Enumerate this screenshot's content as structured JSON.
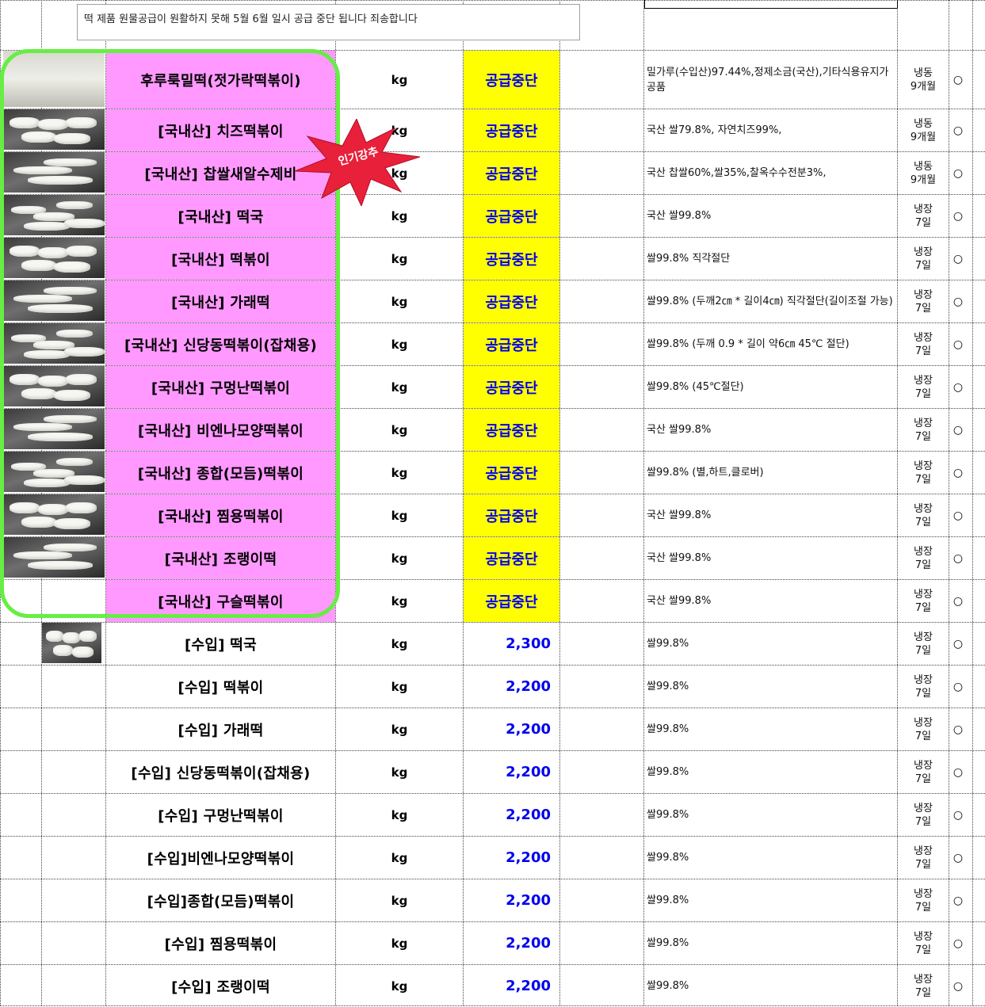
{
  "notice": "떡 제품 원물공급이 원활하지 못해 5월 6월 일시 공급 중단 됩니다 죄송합니다",
  "badge": "인기강추",
  "colors": {
    "highlight": "#ff99ff",
    "suspended_fill": "#ffff00",
    "price_text": "#0000ee",
    "outline": "#66ee44",
    "badge": "#e8203a"
  },
  "rows": [
    {
      "name": "후루룩밀떡(젓가락떡볶이)",
      "unit": "kg",
      "price": "공급중단",
      "desc": "밀가루(수입산)97.44%,정제소금(국산),기타식용유지가공품",
      "storage": [
        "냉동",
        "9개월"
      ],
      "mark": "○",
      "thumb": "product-photo-package-icon",
      "pink": true,
      "stop": true
    },
    {
      "name": "[국내산] 치즈떡볶이",
      "unit": "kg",
      "price": "공급중단",
      "desc": "국산 쌀79.8%, 자연치즈99%,",
      "storage": [
        "냉동",
        "9개월"
      ],
      "mark": "○",
      "thumb": "rice-cake-photo-icon",
      "pink": true,
      "stop": true
    },
    {
      "name": "[국내산] 찹쌀새알수제비",
      "unit": "kg",
      "price": "공급중단",
      "desc": "국산 찹쌀60%,쌀35%,찰옥수수전분3%,",
      "storage": [
        "냉동",
        "9개월"
      ],
      "mark": "○",
      "thumb": "rice-ball-photo-icon",
      "pink": true,
      "stop": true
    },
    {
      "name": "[국내산] 떡국",
      "unit": "kg",
      "price": "공급중단",
      "desc": "국산 쌀99.8%",
      "storage": [
        "냉장",
        "7일"
      ],
      "mark": "○",
      "thumb": "rice-cake-photo-icon",
      "pink": true,
      "stop": true
    },
    {
      "name": "[국내산] 떡볶이",
      "unit": "kg",
      "price": "공급중단",
      "desc": "쌀99.8%  직각절단",
      "storage": [
        "냉장",
        "7일"
      ],
      "mark": "○",
      "thumb": "rice-cake-photo-icon",
      "pink": true,
      "stop": true
    },
    {
      "name": "[국내산] 가래떡",
      "unit": "kg",
      "price": "공급중단",
      "desc": "쌀99.8% (두깨2㎝ * 길이4㎝) 직각절단(길이조절 가능)",
      "storage": [
        "냉장",
        "7일"
      ],
      "mark": "○",
      "thumb": "rice-cake-photo-icon",
      "pink": true,
      "stop": true
    },
    {
      "name": "[국내산] 신당동떡볶이(잡채용)",
      "unit": "kg",
      "price": "공급중단",
      "desc": "쌀99.8% (두깨 0.9 * 길이 약6㎝ 45℃ 절단)",
      "storage": [
        "냉장",
        "7일"
      ],
      "mark": "○",
      "thumb": "rice-cake-photo-icon",
      "pink": true,
      "stop": true
    },
    {
      "name": "[국내산] 구멍난떡볶이",
      "unit": "kg",
      "price": "공급중단",
      "desc": "쌀99.8% (45℃절단)",
      "storage": [
        "냉장",
        "7일"
      ],
      "mark": "○",
      "thumb": "rice-cake-photo-icon",
      "pink": true,
      "stop": true
    },
    {
      "name": "[국내산] 비엔나모양떡볶이",
      "unit": "kg",
      "price": "공급중단",
      "desc": "국산 쌀99.8%",
      "storage": [
        "냉장",
        "7일"
      ],
      "mark": "○",
      "thumb": "rice-cake-photo-icon",
      "pink": true,
      "stop": true
    },
    {
      "name": "[국내산] 종합(모듬)떡볶이",
      "unit": "kg",
      "price": "공급중단",
      "desc": "쌀99.8%  (별,하트,클로버)",
      "storage": [
        "냉장",
        "7일"
      ],
      "mark": "○",
      "thumb": "rice-cake-photo-icon",
      "pink": true,
      "stop": true
    },
    {
      "name": "[국내산] 찜용떡볶이",
      "unit": "kg",
      "price": "공급중단",
      "desc": "국산 쌀99.8%",
      "storage": [
        "냉장",
        "7일"
      ],
      "mark": "○",
      "thumb": "rice-cake-photo-icon",
      "pink": true,
      "stop": true
    },
    {
      "name": "[국내산] 조랭이떡",
      "unit": "kg",
      "price": "공급중단",
      "desc": "국산 쌀99.8%",
      "storage": [
        "냉장",
        "7일"
      ],
      "mark": "○",
      "thumb": "rice-cake-photo-icon",
      "pink": true,
      "stop": true
    },
    {
      "name": "[국내산] 구슬떡볶이",
      "unit": "kg",
      "price": "공급중단",
      "desc": "국산 쌀99.8%",
      "storage": [
        "냉장",
        "7일"
      ],
      "mark": "○",
      "thumb": "",
      "pink": true,
      "stop": true
    },
    {
      "name": "[수입] 떡국",
      "unit": "kg",
      "price": "2,300",
      "desc": "쌀99.8%",
      "storage": [
        "냉장",
        "7일"
      ],
      "mark": "○",
      "thumb": "rice-cake-photo-icon",
      "pink": false,
      "stop": false
    },
    {
      "name": "[수입] 떡볶이",
      "unit": "kg",
      "price": "2,200",
      "desc": "쌀99.8%",
      "storage": [
        "냉장",
        "7일"
      ],
      "mark": "○",
      "thumb": "",
      "pink": false,
      "stop": false
    },
    {
      "name": "[수입] 가래떡",
      "unit": "kg",
      "price": "2,200",
      "desc": "쌀99.8%",
      "storage": [
        "냉장",
        "7일"
      ],
      "mark": "○",
      "thumb": "",
      "pink": false,
      "stop": false
    },
    {
      "name": "[수입] 신당동떡볶이(잡채용)",
      "unit": "kg",
      "price": "2,200",
      "desc": "쌀99.8%",
      "storage": [
        "냉장",
        "7일"
      ],
      "mark": "○",
      "thumb": "",
      "pink": false,
      "stop": false
    },
    {
      "name": "[수입] 구멍난떡볶이",
      "unit": "kg",
      "price": "2,200",
      "desc": "쌀99.8%",
      "storage": [
        "냉장",
        "7일"
      ],
      "mark": "○",
      "thumb": "",
      "pink": false,
      "stop": false
    },
    {
      "name": "[수입]비엔나모양떡볶이",
      "unit": "kg",
      "price": "2,200",
      "desc": "쌀99.8%",
      "storage": [
        "냉장",
        "7일"
      ],
      "mark": "○",
      "thumb": "",
      "pink": false,
      "stop": false
    },
    {
      "name": "[수입]종합(모듬)떡볶이",
      "unit": "kg",
      "price": "2,200",
      "desc": "쌀99.8%",
      "storage": [
        "냉장",
        "7일"
      ],
      "mark": "○",
      "thumb": "",
      "pink": false,
      "stop": false
    },
    {
      "name": "[수입] 찜용떡볶이",
      "unit": "kg",
      "price": "2,200",
      "desc": "쌀99.8%",
      "storage": [
        "냉장",
        "7일"
      ],
      "mark": "○",
      "thumb": "",
      "pink": false,
      "stop": false
    },
    {
      "name": "[수입] 조랭이떡",
      "unit": "kg",
      "price": "2,200",
      "desc": "쌀99.8%",
      "storage": [
        "냉장",
        "7일"
      ],
      "mark": "○",
      "thumb": "",
      "pink": false,
      "stop": false
    }
  ]
}
